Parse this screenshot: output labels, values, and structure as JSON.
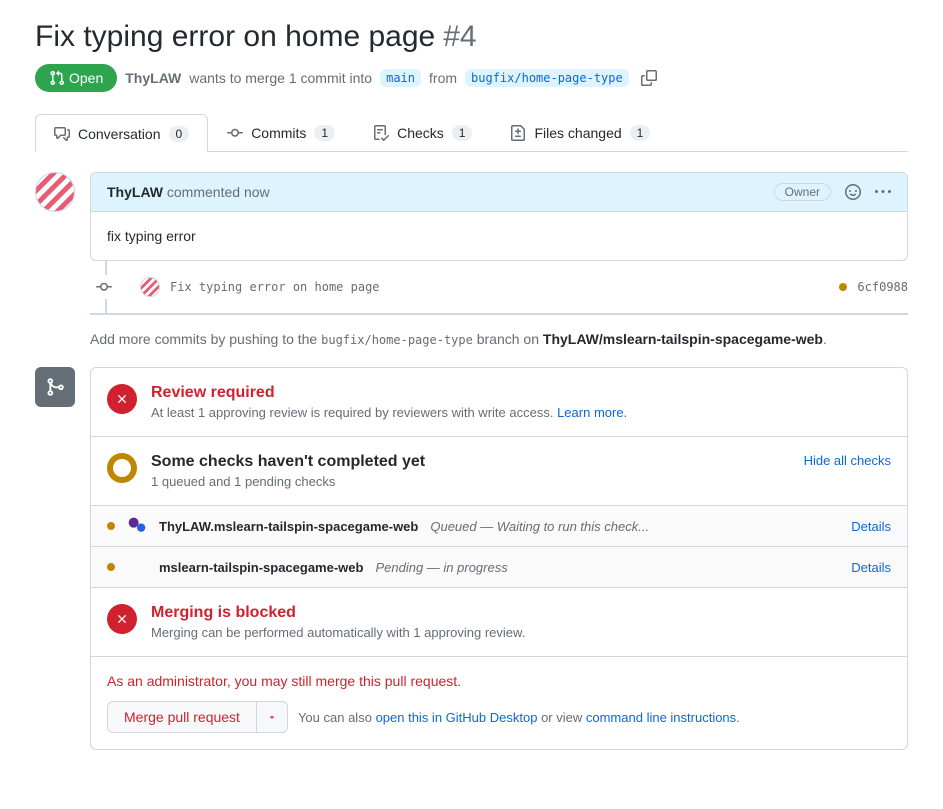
{
  "title": "Fix typing error on home page",
  "pr_number": "#4",
  "state": "Open",
  "meta": {
    "author": "ThyLAW",
    "text1": "wants to merge 1 commit into",
    "base": "main",
    "text2": "from",
    "head": "bugfix/home-page-type"
  },
  "tabs": {
    "conversation": {
      "label": "Conversation",
      "count": "0"
    },
    "commits": {
      "label": "Commits",
      "count": "1"
    },
    "checks": {
      "label": "Checks",
      "count": "1"
    },
    "files": {
      "label": "Files changed",
      "count": "1"
    }
  },
  "comment": {
    "author": "ThyLAW",
    "verb": "commented",
    "time": "now",
    "role": "Owner",
    "body": "fix typing error"
  },
  "commit": {
    "msg": "Fix typing error on home page",
    "sha": "6cf0988"
  },
  "push_hint": {
    "prefix": "Add more commits by pushing to the",
    "branch": "bugfix/home-page-type",
    "mid": "branch on",
    "repo": "ThyLAW/mslearn-tailspin-spacegame-web"
  },
  "review": {
    "title": "Review required",
    "desc": "At least 1 approving review is required by reviewers with write access.",
    "learn": "Learn more."
  },
  "checks_box": {
    "title": "Some checks haven't completed yet",
    "desc": "1 queued and 1 pending checks",
    "hide": "Hide all checks"
  },
  "checks": [
    {
      "name": "ThyLAW.mslearn-tailspin-spacegame-web",
      "status": "Queued — Waiting to run this check...",
      "details": "Details"
    },
    {
      "name": "mslearn-tailspin-spacegame-web",
      "status": "Pending — in progress",
      "details": "Details"
    }
  ],
  "blocked": {
    "title": "Merging is blocked",
    "desc": "Merging can be performed automatically with 1 approving review."
  },
  "admin": {
    "text": "As an administrator, you may still merge this pull request.",
    "btn": "Merge pull request",
    "also1": "You can also",
    "open_desktop": "open this in GitHub Desktop",
    "also2": "or view",
    "cli": "command line instructions"
  }
}
